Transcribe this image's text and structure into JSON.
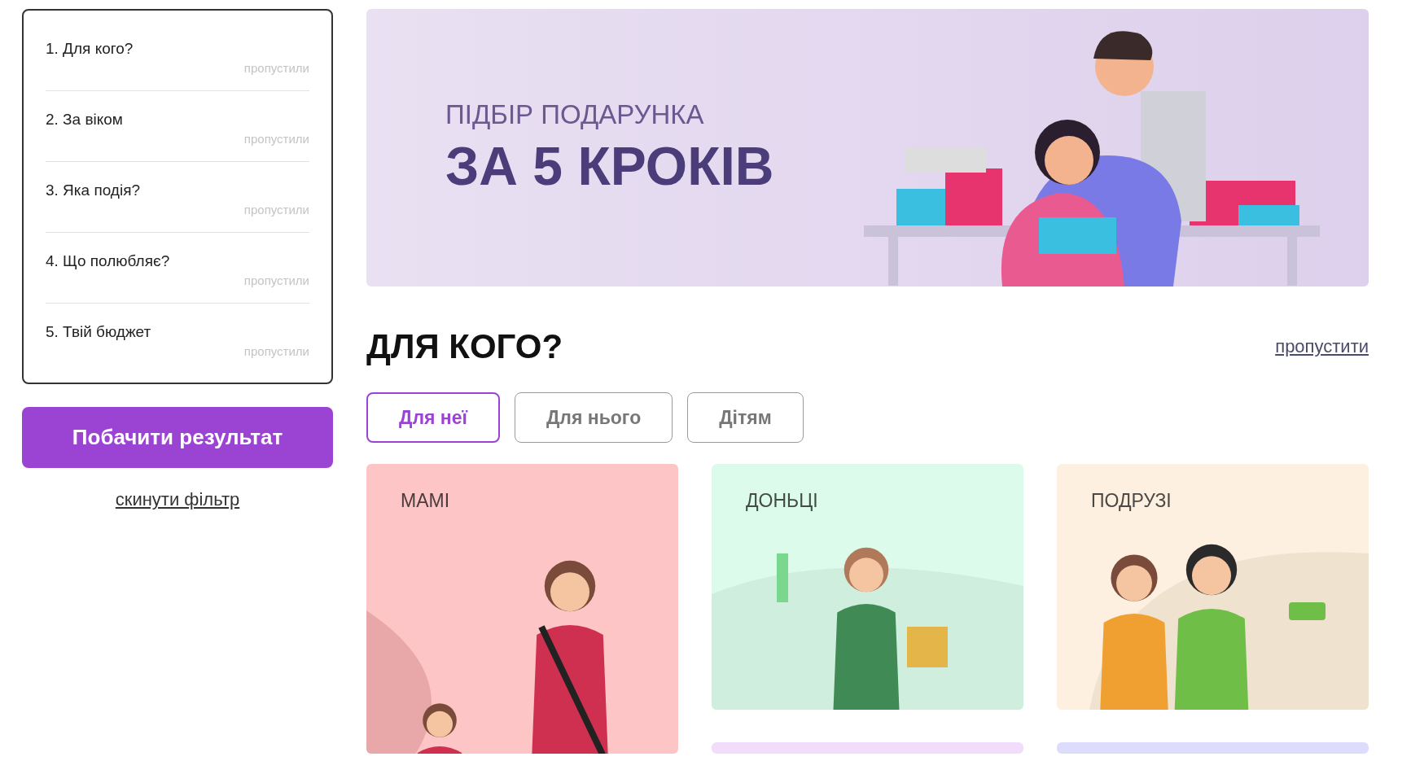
{
  "steps": [
    {
      "label": "1. Для кого?",
      "status": "пропустили"
    },
    {
      "label": "2. За віком",
      "status": "пропустили"
    },
    {
      "label": "3. Яка подія?",
      "status": "пропустили"
    },
    {
      "label": "4. Що полюбляє?",
      "status": "пропустили"
    },
    {
      "label": "5. Твій бюджет",
      "status": "пропустили"
    }
  ],
  "result_button": "Побачити результат",
  "reset_link": "скинути фільтр",
  "banner": {
    "subtitle": "ПІДБІР ПОДАРУНКА",
    "title": "ЗА 5 КРОКІВ"
  },
  "section": {
    "title": "ДЛЯ КОГО?",
    "skip_link": "пропустити"
  },
  "chips": [
    {
      "label": "Для неї",
      "selected": true
    },
    {
      "label": "Для нього",
      "selected": false
    },
    {
      "label": "Дітям",
      "selected": false
    }
  ],
  "cards": [
    {
      "label": "МАМІ",
      "color": "#fdc5c5"
    },
    {
      "label": "ДОНЬЦІ",
      "color": "#dcfbea"
    },
    {
      "label": "ПОДРУЗІ",
      "color": "#fdf0e0"
    },
    {
      "color": "#f1ddfb"
    },
    {
      "color": "#dedcfc"
    }
  ]
}
